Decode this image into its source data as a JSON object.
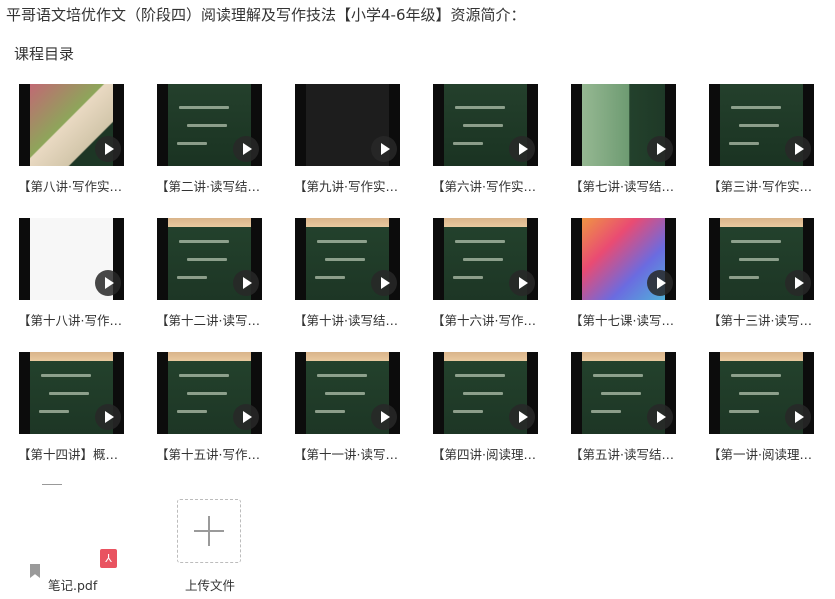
{
  "page": {
    "title": "平哥语文培优作文（阶段四）阅读理解及写作技法【小学4-6年级】资源简介：",
    "section_title": "课程目录"
  },
  "videos": [
    {
      "label": "【第八讲·写作实…",
      "thumb": "photo1"
    },
    {
      "label": "【第二讲·读写结…",
      "thumb": "green"
    },
    {
      "label": "【第九讲·写作实…",
      "thumb": "black"
    },
    {
      "label": "【第六讲·写作实…",
      "thumb": "green"
    },
    {
      "label": "【第七讲·读写结…",
      "thumb": "photo2"
    },
    {
      "label": "【第三讲·写作实…",
      "thumb": "green"
    },
    {
      "label": "【第十八讲·写作…",
      "thumb": "white"
    },
    {
      "label": "【第十二讲·读写…",
      "thumb": "wood"
    },
    {
      "label": "【第十讲·读写结…",
      "thumb": "wood"
    },
    {
      "label": "【第十六讲·写作…",
      "thumb": "wood"
    },
    {
      "label": "【第十七课·读写…",
      "thumb": "apple"
    },
    {
      "label": "【第十三讲·读写…",
      "thumb": "wood"
    },
    {
      "label": "【第十四讲】概…",
      "thumb": "wood"
    },
    {
      "label": "【第十五讲·写作…",
      "thumb": "wood"
    },
    {
      "label": "【第十一讲·读写…",
      "thumb": "wood"
    },
    {
      "label": "【第四讲·阅读理…",
      "thumb": "wood"
    },
    {
      "label": "【第五讲·读写结…",
      "thumb": "wood"
    },
    {
      "label": "【第一讲·阅读理…",
      "thumb": "wood"
    }
  ],
  "file": {
    "name": "笔记.pdf",
    "badge": "⅄"
  },
  "upload": {
    "label": "上传文件",
    "icon": "plus-icon"
  }
}
